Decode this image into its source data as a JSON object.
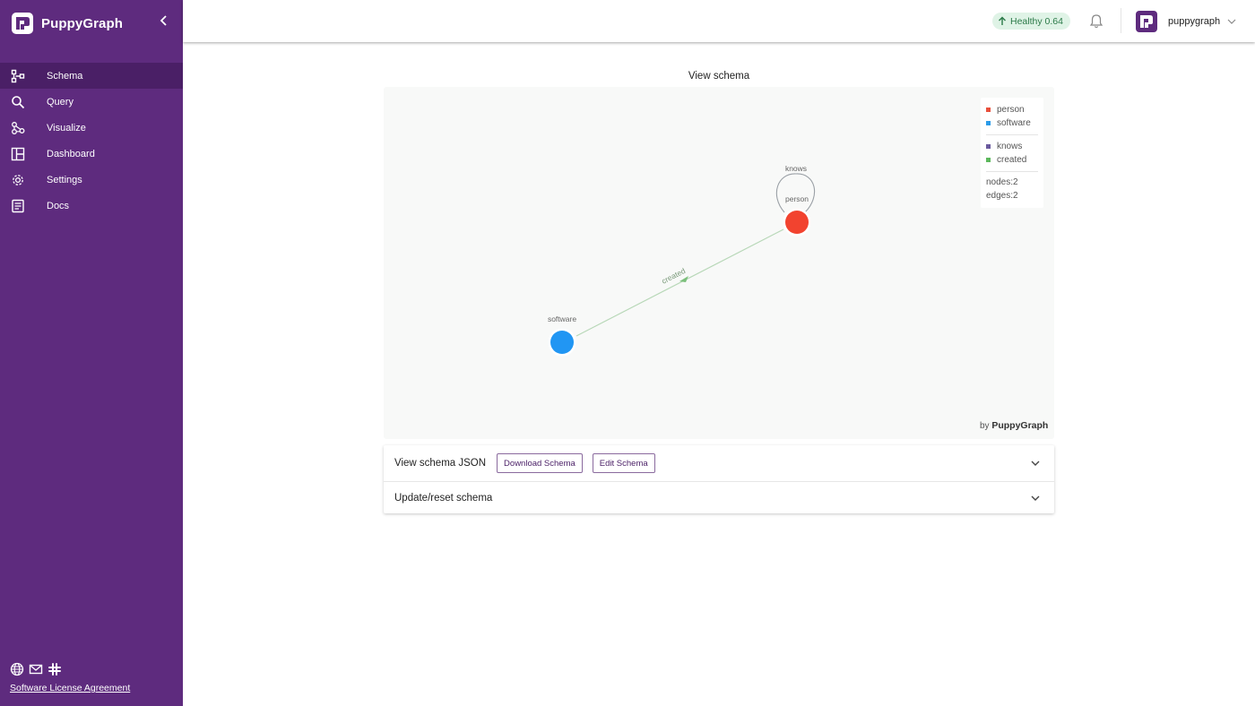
{
  "app": {
    "name": "PuppyGraph"
  },
  "sidebar": {
    "items": [
      {
        "label": "Schema",
        "icon": "schema-icon",
        "active": true
      },
      {
        "label": "Query",
        "icon": "search-icon",
        "active": false
      },
      {
        "label": "Visualize",
        "icon": "graph-nodes-icon",
        "active": false
      },
      {
        "label": "Dashboard",
        "icon": "dashboard-icon",
        "active": false
      },
      {
        "label": "Settings",
        "icon": "gear-icon",
        "active": false
      },
      {
        "label": "Docs",
        "icon": "document-icon",
        "active": false
      }
    ],
    "footer": {
      "icons": [
        "globe-icon",
        "mail-icon",
        "slack-icon"
      ],
      "license_link": "Software License Agreement"
    }
  },
  "header": {
    "health": "Healthy 0.64",
    "user_name": "puppygraph"
  },
  "main": {
    "title": "View schema",
    "byline_prefix": "by",
    "byline_brand": "PuppyGraph"
  },
  "legend": {
    "nodes": [
      {
        "label": "person",
        "color": "#e8503c"
      },
      {
        "label": "software",
        "color": "#2b9be8"
      }
    ],
    "edges": [
      {
        "label": "knows",
        "color": "#6a5a9e"
      },
      {
        "label": "created",
        "color": "#5cb85c"
      }
    ],
    "stats": [
      "nodes:2",
      "edges:2"
    ]
  },
  "graph": {
    "nodes": [
      {
        "id": "person",
        "label": "person",
        "color": "#f2432f"
      },
      {
        "id": "software",
        "label": "software",
        "color": "#2196f3"
      }
    ],
    "edges": [
      {
        "label": "knows",
        "source": "person",
        "target": "person"
      },
      {
        "label": "created",
        "source": "person",
        "target": "software"
      }
    ]
  },
  "accordion": {
    "schema_json_title": "View schema JSON",
    "download_label": "Download Schema",
    "edit_label": "Edit Schema",
    "update_title": "Update/reset schema"
  },
  "colors": {
    "sidebar_bg": "#5e2b7e",
    "sidebar_active": "#4a1f66",
    "health_bg": "#dff3e6",
    "health_text": "#2b7a48"
  }
}
